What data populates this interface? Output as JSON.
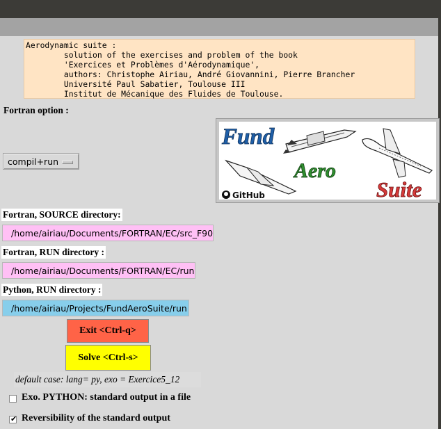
{
  "info_text": "Aerodynamic suite :\n        solution of the exercises and problem of the book\n        'Exercices et Problèmes d'Aérodynamique',\n        authors: Christophe Airiau, André Giovannini, Pierre Brancher\n        Université Paul Sabatier, Toulouse III\n        Institut de Mécanique des Fluides de Toulouse.",
  "fortran_option": {
    "label": "Fortran option :",
    "selected": "compil+run"
  },
  "logo": {
    "word1": "Fund",
    "word2": "Aero",
    "word3": "Suite",
    "badge": "GitHub"
  },
  "fortran_source": {
    "label": "Fortran, SOURCE directory:",
    "path": "/home/airiau/Documents/FORTRAN/EC/src_F90"
  },
  "fortran_run": {
    "label": "Fortran, RUN directory :",
    "path": "/home/airiau/Documents/FORTRAN/EC/run"
  },
  "python_run": {
    "label": "Python, RUN directory :",
    "path": "/home/airiau/Projects/FundAeroSuite/run"
  },
  "buttons": {
    "exit": "Exit <Ctrl-q>",
    "solve": "Solve <Ctrl-s>"
  },
  "default_case": "default case: lang= py, exo = Exercice5_12",
  "checkboxes": [
    {
      "label": "Exo. PYTHON: standard output in a file",
      "checked": false
    },
    {
      "label": "Reversibility of the standard output",
      "checked": true
    }
  ],
  "colors": {
    "exit": "#ff6347",
    "solve": "#ffff00",
    "path_pink": "#ffc0f5",
    "path_blue": "#87ceeb",
    "info_bg": "#ffe4c4"
  }
}
